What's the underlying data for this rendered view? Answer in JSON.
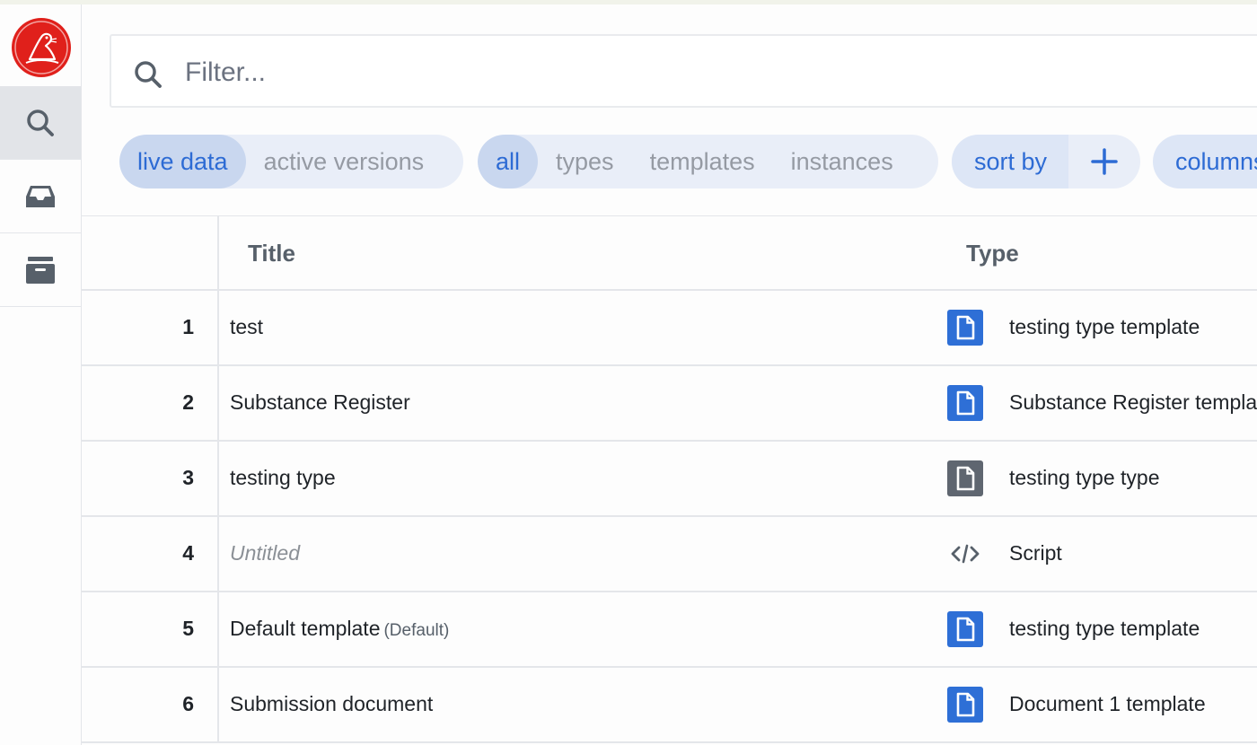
{
  "filter": {
    "placeholder": "Filter..."
  },
  "pills": {
    "data_mode": [
      {
        "label": "live data",
        "selected": true
      },
      {
        "label": "active versions",
        "selected": false
      }
    ],
    "kind": [
      {
        "label": "all",
        "selected": true
      },
      {
        "label": "types",
        "selected": false
      },
      {
        "label": "templates",
        "selected": false
      },
      {
        "label": "instances",
        "selected": false
      }
    ],
    "sort_label": "sort by",
    "columns_label": "columns"
  },
  "table": {
    "headers": {
      "title": "Title",
      "type": "Type"
    },
    "rows": [
      {
        "num": "1",
        "title": "test",
        "badge": "",
        "untitled": false,
        "type": "testing type template",
        "icon": "document-blue-icon"
      },
      {
        "num": "2",
        "title": "Substance Register",
        "badge": "",
        "untitled": false,
        "type": "Substance Register template",
        "icon": "document-blue-icon"
      },
      {
        "num": "3",
        "title": "testing type",
        "badge": "",
        "untitled": false,
        "type": "testing type type",
        "icon": "document-gray-icon"
      },
      {
        "num": "4",
        "title": "Untitled",
        "badge": "",
        "untitled": true,
        "type": "Script",
        "icon": "code-icon"
      },
      {
        "num": "5",
        "title": "Default template",
        "badge": "(Default)",
        "untitled": false,
        "type": "testing type template",
        "icon": "document-blue-icon"
      },
      {
        "num": "6",
        "title": "Submission document",
        "badge": "",
        "untitled": false,
        "type": "Document 1 template",
        "icon": "document-blue-icon"
      }
    ]
  },
  "colors": {
    "accent": "#2d6bd4",
    "doc_blue": "#2e6fd6",
    "doc_gray": "#5f6670",
    "logo_red": "#e0201b"
  }
}
